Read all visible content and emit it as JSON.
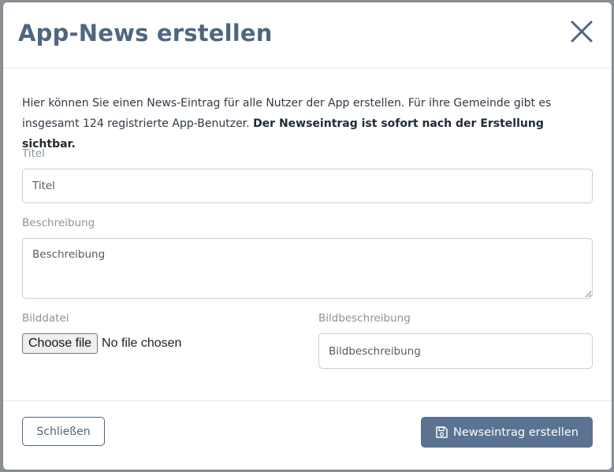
{
  "modal": {
    "title": "App-News erstellen",
    "intro_text": "Hier können Sie einen News-Eintrag für alle Nutzer der App erstellen. Für ihre Gemeinde gibt es insgesamt 124 registrierte App-Benutzer. ",
    "intro_bold": "Der Newseintrag ist sofort nach der Erstellung sichtbar."
  },
  "form": {
    "title_label": "Titel",
    "title_placeholder": "Titel",
    "description_label": "Beschreibung",
    "description_placeholder": "Beschreibung",
    "image_file_label": "Bilddatei",
    "file_button_label": "Choose file",
    "file_status": "No file chosen",
    "image_description_label": "Bildbeschreibung",
    "image_description_placeholder": "Bildbeschreibung"
  },
  "footer": {
    "close_label": "Schließen",
    "create_label": "Newseintrag erstellen"
  },
  "colors": {
    "accent": "#4f6680",
    "primary_button": "#5a7391"
  },
  "icons": {
    "close": "close-icon",
    "save": "save-icon"
  }
}
